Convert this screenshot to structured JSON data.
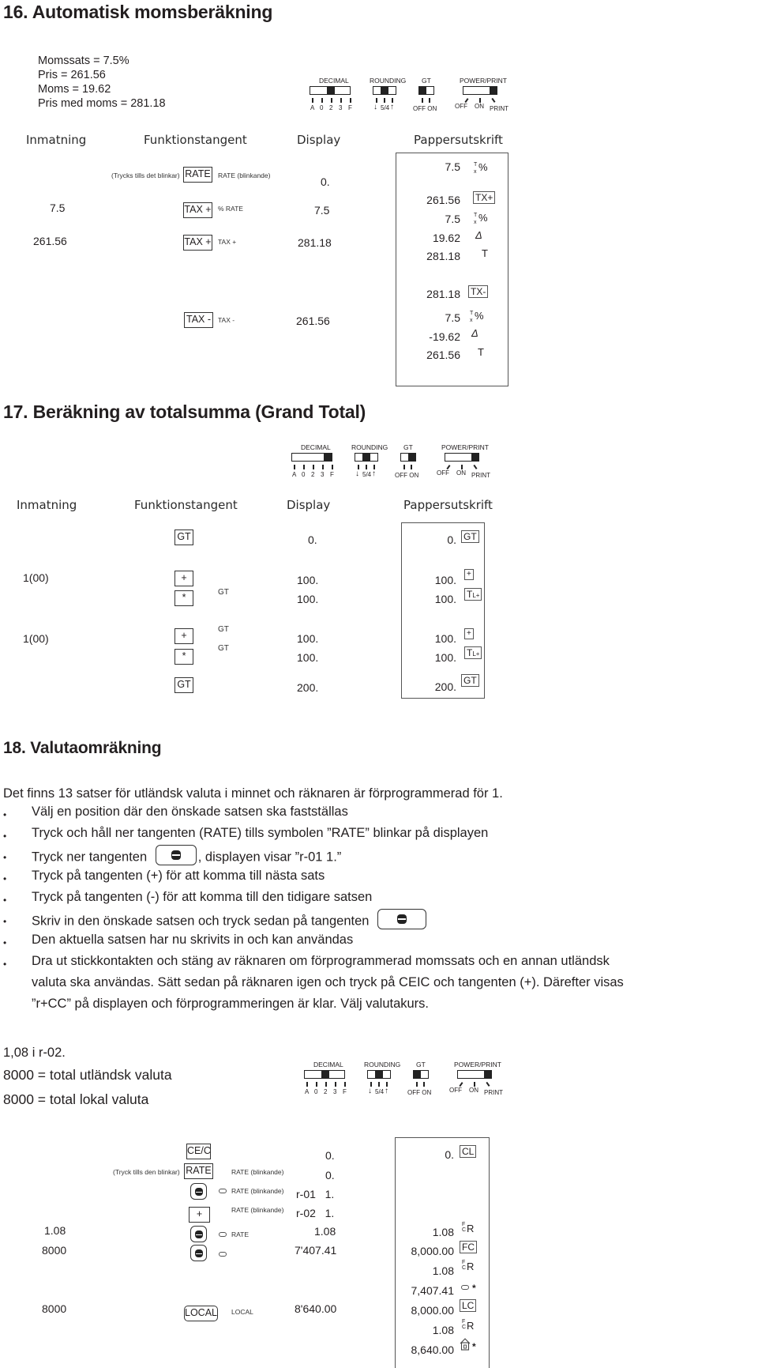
{
  "section16": {
    "title": "16. Automatisk momsberäkning",
    "given": [
      "Momssats = 7.5%",
      "Pris = 261.56",
      "Moms = 19.62",
      "Pris med moms = 281.18"
    ],
    "switches": {
      "decimal": {
        "label": "DECIMAL",
        "options": [
          "A",
          "0",
          "2",
          "3",
          "F"
        ],
        "selected": "2"
      },
      "rounding": {
        "label": "ROUNDING",
        "options": [
          "↓",
          "5/4",
          "↑"
        ],
        "selected": "5/4"
      },
      "gt": {
        "label": "GT",
        "options": [
          "OFF",
          "ON"
        ],
        "selected": "OFF"
      },
      "power": {
        "label": "POWER/PRINT",
        "options": [
          "OFF",
          "ON",
          "PRINT"
        ],
        "selected": "PRINT"
      }
    },
    "columns": [
      "Inmatning",
      "Funktionstangent",
      "Display",
      "Pappersutskrift"
    ],
    "rows": [
      {
        "input": "",
        "note": "(Trycks tills det blinkar)",
        "key": "RATE",
        "annot": "RATE (blinkande)",
        "display": "0."
      },
      {
        "input": "7.5",
        "key": "TAX +",
        "annot": "% RATE",
        "display": "7.5"
      },
      {
        "input": "261.56",
        "key": "TAX +",
        "annot": "TAX +",
        "display": "281.18"
      },
      {
        "input": "",
        "key": "TAX -",
        "annot": "TAX -",
        "display": "261.56"
      }
    ],
    "tape": [
      {
        "value": "7.5",
        "symbol": "T/x %"
      },
      {
        "value": "261.56",
        "symbol": "TX+"
      },
      {
        "value": "7.5",
        "symbol": "T/x %"
      },
      {
        "value": "19.62",
        "symbol": "Δ"
      },
      {
        "value": "281.18",
        "symbol": "T"
      },
      {
        "value": "281.18",
        "symbol": "TX-"
      },
      {
        "value": "7.5",
        "symbol": "T/x %"
      },
      {
        "value": "-19.62",
        "symbol": "Δ"
      },
      {
        "value": "261.56",
        "symbol": "T"
      }
    ]
  },
  "section17": {
    "title": "17. Beräkning av totalsumma (Grand Total)",
    "switches": {
      "decimal": {
        "label": "DECIMAL",
        "options": [
          "A",
          "0",
          "2",
          "3",
          "F"
        ],
        "selected": "F"
      },
      "rounding": {
        "label": "ROUNDING",
        "options": [
          "↓",
          "5/4",
          "↑"
        ],
        "selected": "5/4"
      },
      "gt": {
        "label": "GT",
        "options": [
          "OFF",
          "ON"
        ],
        "selected": "ON"
      },
      "power": {
        "label": "POWER/PRINT",
        "options": [
          "OFF",
          "ON",
          "PRINT"
        ],
        "selected": "PRINT"
      }
    },
    "columns": [
      "Inmatning",
      "Funktionstangent",
      "Display",
      "Pappersutskrift"
    ],
    "rows": [
      {
        "input": "",
        "key": "GT",
        "annot": "",
        "display": "0."
      },
      {
        "input": "1(00)",
        "key": "+",
        "annot": "",
        "display": "100."
      },
      {
        "input": "",
        "key": "*",
        "annot": "GT",
        "display": "100."
      },
      {
        "input": "1(00)",
        "key": "+",
        "annot": "GT",
        "display": "100."
      },
      {
        "input": "",
        "key": "*",
        "annot": "GT",
        "display": "100."
      },
      {
        "input": "",
        "key": "GT",
        "annot": "",
        "display": "200."
      }
    ],
    "tape": [
      {
        "value": "0.",
        "symbol": "GT"
      },
      {
        "value": "100.",
        "symbol": "+"
      },
      {
        "value": "100.",
        "symbol": "TL+"
      },
      {
        "value": "100.",
        "symbol": "+"
      },
      {
        "value": "100.",
        "symbol": "TL+"
      },
      {
        "value": "200.",
        "symbol": "GT"
      }
    ]
  },
  "section18": {
    "title": "18. Valutaomräkning",
    "intro": "Det finns 13 satser för utländsk valuta i minnet och räknaren är förprogrammerad för 1.",
    "bullets": [
      "Välj en position där den önskade satsen ska fastställas",
      "Tryck och håll ner tangenten (RATE) tills symbolen ”RATE” blinkar på displayen",
      {
        "before": "Tryck ner tangenten",
        "after": ", displayen visar ”r-01  1.”"
      },
      "Tryck på tangenten (+) för att komma till nästa sats",
      "Tryck på tangenten (-) för att komma till den tidigare satsen",
      {
        "before": "Skriv in den önskade satsen och tryck sedan på tangenten",
        "after": ""
      },
      "Den aktuella satsen har nu skrivits in och kan användas",
      [
        "Dra ut stickkontakten och stäng av räknaren om förprogrammerad momssats och en annan utländsk",
        "valuta ska användas. Sätt sedan på räknaren igen och tryck på CEIC och tangenten (+). Därefter visas",
        "”r+CC” på displayen och förprogrammeringen är klar. Välj valutakurs."
      ]
    ],
    "given": [
      "1,08 i r-02.",
      "8000 = total utländsk valuta",
      "8000 = total lokal valuta"
    ],
    "switches": {
      "decimal": {
        "label": "DECIMAL",
        "options": [
          "A",
          "0",
          "2",
          "3",
          "F"
        ],
        "selected": "2"
      },
      "rounding": {
        "label": "ROUNDING",
        "options": [
          "↓",
          "5/4",
          "↑"
        ],
        "selected": "5/4"
      },
      "gt": {
        "label": "GT",
        "options": [
          "OFF",
          "ON"
        ],
        "selected": "OFF"
      },
      "power": {
        "label": "POWER/PRINT",
        "options": [
          "OFF",
          "ON",
          "PRINT"
        ],
        "selected": "PRINT"
      }
    },
    "rows": [
      {
        "input": "",
        "key": "CE/C",
        "annot": "",
        "display": "0."
      },
      {
        "input": "",
        "note": "(Tryck tills den blinkar)",
        "key": "RATE",
        "annot": "RATE (blinkande)",
        "display": "0."
      },
      {
        "input": "",
        "key": "currency-key",
        "annot": "RATE (blinkande)",
        "display": "r-01   1."
      },
      {
        "input": "",
        "key": "+",
        "annot": "RATE (blinkande)",
        "display": "r-02   1."
      },
      {
        "input": "1.08",
        "key": "currency-key",
        "annot": "RATE",
        "display": "1.08"
      },
      {
        "input": "8000",
        "key": "currency-key",
        "annot": "",
        "display": "7'407.41"
      },
      {
        "input": "8000",
        "key": "LOCAL",
        "annot": "LOCAL",
        "display": "8'640.00"
      }
    ],
    "tape": [
      {
        "value": "0.",
        "symbol": "CL"
      },
      {
        "value": "1.08",
        "symbol": "F/C R"
      },
      {
        "value": "8,000.00",
        "symbol": "FC"
      },
      {
        "value": "1.08",
        "symbol": "F/C R"
      },
      {
        "value": "7,407.41",
        "symbol": "currency *"
      },
      {
        "value": "8,000.00",
        "symbol": "LC"
      },
      {
        "value": "1.08",
        "symbol": "F/C R"
      },
      {
        "value": "8,640.00",
        "symbol": "home *"
      }
    ]
  }
}
